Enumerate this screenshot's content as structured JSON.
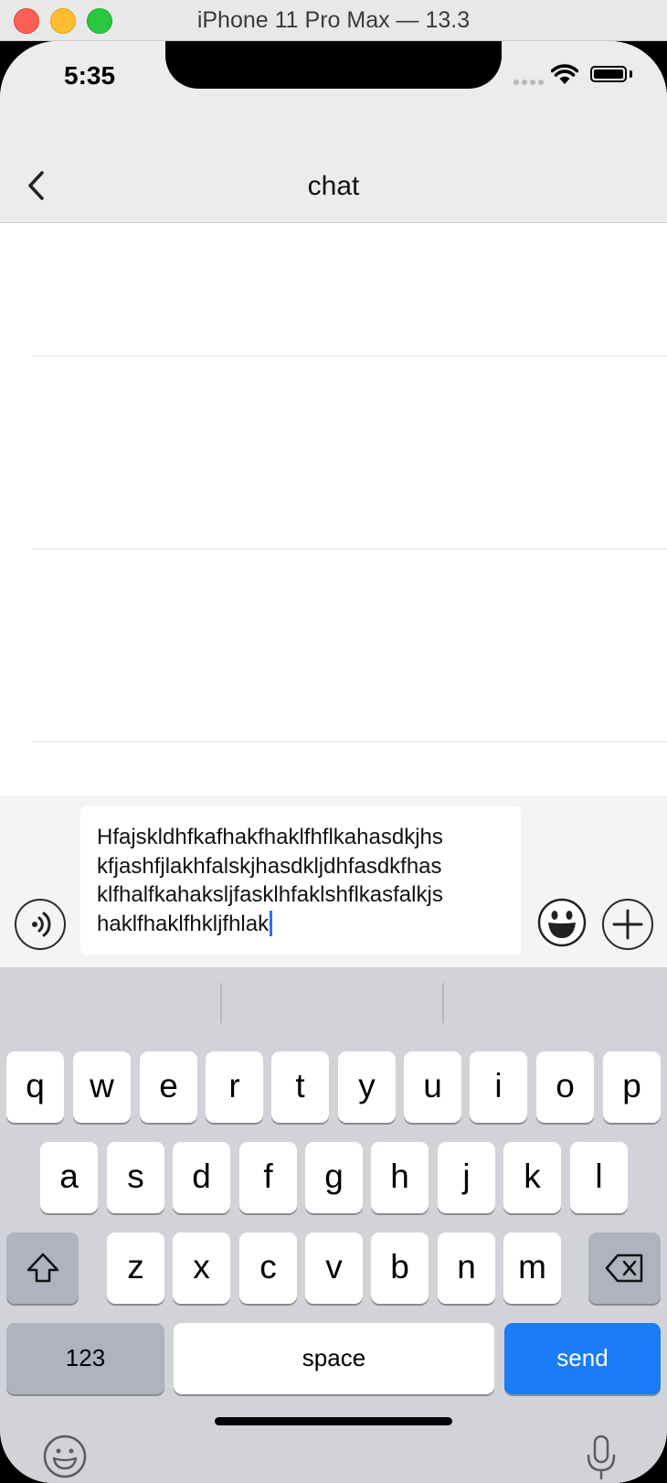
{
  "window": {
    "title": "iPhone 11 Pro Max — 13.3"
  },
  "status_bar": {
    "time": "5:35"
  },
  "nav": {
    "title": "chat"
  },
  "composer": {
    "lines": [
      "Hfajskldhfkafhakfhaklfhflkahasdkjhs",
      "kfjashfjlakhfalskjhasdkljdhfasdkfhas",
      "klfhalfkahaksljfasklhfaklshflkasfalkjs",
      "haklfhaklfhkljfhlak"
    ]
  },
  "keyboard": {
    "row1": [
      "q",
      "w",
      "e",
      "r",
      "t",
      "y",
      "u",
      "i",
      "o",
      "p"
    ],
    "row2": [
      "a",
      "s",
      "d",
      "f",
      "g",
      "h",
      "j",
      "k",
      "l"
    ],
    "row3": [
      "z",
      "x",
      "c",
      "v",
      "b",
      "n",
      "m"
    ],
    "numbers_label": "123",
    "space_label": "space",
    "send_label": "send"
  },
  "colors": {
    "send_key": "#1a7cf6",
    "caret": "#2f6ff7"
  }
}
